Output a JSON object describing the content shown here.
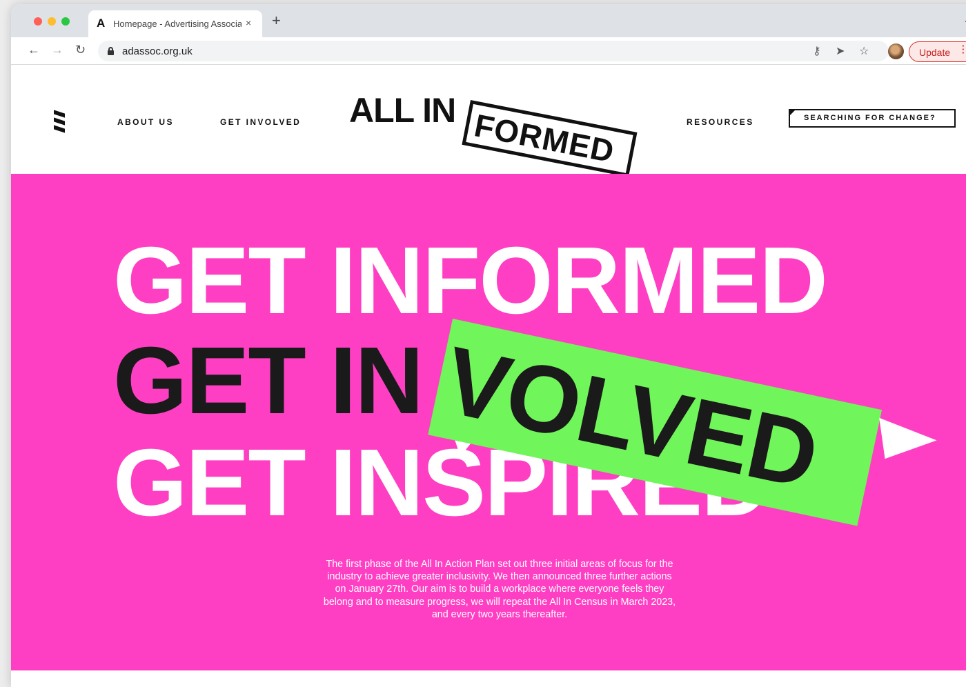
{
  "browser": {
    "tab": {
      "favicon": "A",
      "title": "Homepage - Advertising Association",
      "close": "×"
    },
    "new_tab": "+",
    "tabstrip_menu": "⌄",
    "nav": {
      "back": "←",
      "forward": "→",
      "reload": "↻"
    },
    "address": {
      "url": "adassoc.org.uk"
    },
    "toolbar_icons": {
      "key": "⚷",
      "send": "➤",
      "star": "☆"
    },
    "update_label": "Update",
    "colors": {
      "tab_strip": "#dee1e6",
      "update_accent": "#d93025"
    }
  },
  "site": {
    "nav": {
      "about": "ABOUT US",
      "get_involved": "GET INVOLVED",
      "resources": "RESOURCES",
      "search_cta": "SEARCHING FOR CHANGE?"
    },
    "logo": {
      "left": "ALL IN",
      "tag": "FORMED"
    },
    "hero": {
      "line1": "GET INFORMED",
      "line2_prefix": "GET IN",
      "sticker": "VOLVED",
      "line3": "GET INSPIRED",
      "copy": "The first phase of the All In Action Plan set out three initial areas of focus for the industry to achieve greater inclusivity. We then announced three further actions on January 27th. Our aim is to build a workplace where everyone feels they belong and to measure progress, we will repeat the All In Census in March 2023, and every two years thereafter."
    },
    "colors": {
      "hero_background": "#ff3fc3",
      "sticker": "#70f55a",
      "ink": "#1a1a1a"
    }
  }
}
